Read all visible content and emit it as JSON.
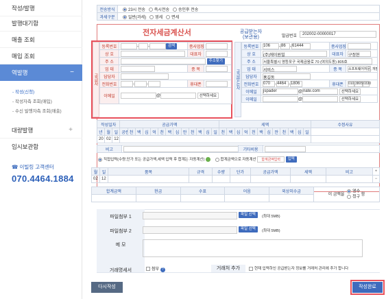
{
  "sidebar": {
    "items": [
      "작성/발행",
      "발행대기함",
      "매출 조회",
      "매입 조회",
      "역발행",
      "대량발행",
      "임시보관함"
    ],
    "sub_items": [
      "- 작성(신청)",
      "- 작성자측 조회(매입)",
      "- 수신 발행자측 조회(매출)"
    ],
    "support_label": "이빌링 고객센터",
    "support_phone": "070.4464.1884"
  },
  "issue": {
    "method_label": "전송방식",
    "methods": [
      "23시 전송",
      "즉시전송",
      "승인후 전송"
    ],
    "tax_label": "과세구분",
    "taxes": [
      "일반(과세)",
      "영세",
      "면세"
    ]
  },
  "supplier": {
    "title": "전자세금계산서",
    "side_label": "공급자",
    "reg_no": "등록번호",
    "confirm": "검색",
    "sub_branch": "종사업장",
    "company": "상 호",
    "ceo": "대표자",
    "address": "주 소",
    "addr_btn": "주소찾기",
    "business": "업 태",
    "item": "종 목",
    "manager": "담당자",
    "phone": "전화번호",
    "mobile": "휴대폰",
    "email": "이메일",
    "at": "@",
    "email_select": "선택하세요"
  },
  "buyer": {
    "title": "공급받는자\n(보관용)",
    "doc_label": "발급번호",
    "doc_no": "202002-00000017",
    "side_label": "공급받는자",
    "reg_no": "등록번호",
    "reg_parts": [
      "106",
      "86",
      "61444"
    ],
    "sub_branch": "종사업장",
    "company": "상 호",
    "company_val": "(주)에이원빌",
    "ceo": "대표자",
    "ceo_val": "구정현",
    "address": "주 소",
    "address_val": "서울특별시 영등포구 국제금융로 70 (여의도동) 805호",
    "business": "업 태",
    "business_val": "서비스",
    "item": "종 목",
    "item_val": "소프트웨어자문, 개발및공급",
    "manager": "담당자",
    "manager_val": "홍길동",
    "phone": "전화번호",
    "phone_parts": [
      "070",
      "4464",
      "1806"
    ],
    "mobile": "휴대폰",
    "mobile_parts": [
      "010",
      "3805",
      "0330"
    ],
    "email": "이메일",
    "email_user": "jspader",
    "email_domain": "nate.com",
    "email2": "이메일",
    "at": "@",
    "email_select": "선택하세요"
  },
  "amounts": {
    "date_label": "작성일자",
    "supply_label": "공급가액",
    "tax_label": "세액",
    "reason_label": "수정사유",
    "cols": [
      "년",
      "월",
      "일",
      "공란수",
      "천",
      "백",
      "십",
      "억",
      "천",
      "백",
      "십",
      "만",
      "천",
      "백",
      "십",
      "일",
      "천",
      "백",
      "십",
      "억",
      "천",
      "백",
      "십",
      "만",
      "천",
      "백",
      "십",
      "일"
    ],
    "year": "20",
    "month": "02",
    "day": "12",
    "note_label": "비고",
    "other_label": "기타비용"
  },
  "mode": {
    "text1": "직접입력(수량,단가 또는 공급가액,세액 입력 후 합계는 자동계산)",
    "text2": "합계금액으로 자동계산",
    "placeholder": "합계금액입력",
    "enter_btn": "입력"
  },
  "items_table": {
    "headers": [
      "월",
      "일",
      "품목",
      "규격",
      "수량",
      "단가",
      "공급가액",
      "세액",
      "비고"
    ],
    "month": "02",
    "day": "12"
  },
  "summary": {
    "headers": [
      "합계금액",
      "현금",
      "수표",
      "어음",
      "외상미수금"
    ],
    "label": "이 금액을",
    "opt1": "영수",
    "opt2": "청구",
    "unit": "함"
  },
  "attach": {
    "file1": "파일첨부 1",
    "file2": "파일첨부 2",
    "btn": "파일 선택",
    "limit": "(최대 5MB)",
    "memo": "메 모",
    "deal_doc": "거래명세서",
    "attach_opt": "첨부",
    "partner_add": "거래처 추가",
    "partner_text": "현재 입력하신 공급받는자 정보를 거래처 관리에 추가 합니다"
  },
  "buttons": {
    "reset": "다시작성",
    "submit": "작성완료"
  }
}
